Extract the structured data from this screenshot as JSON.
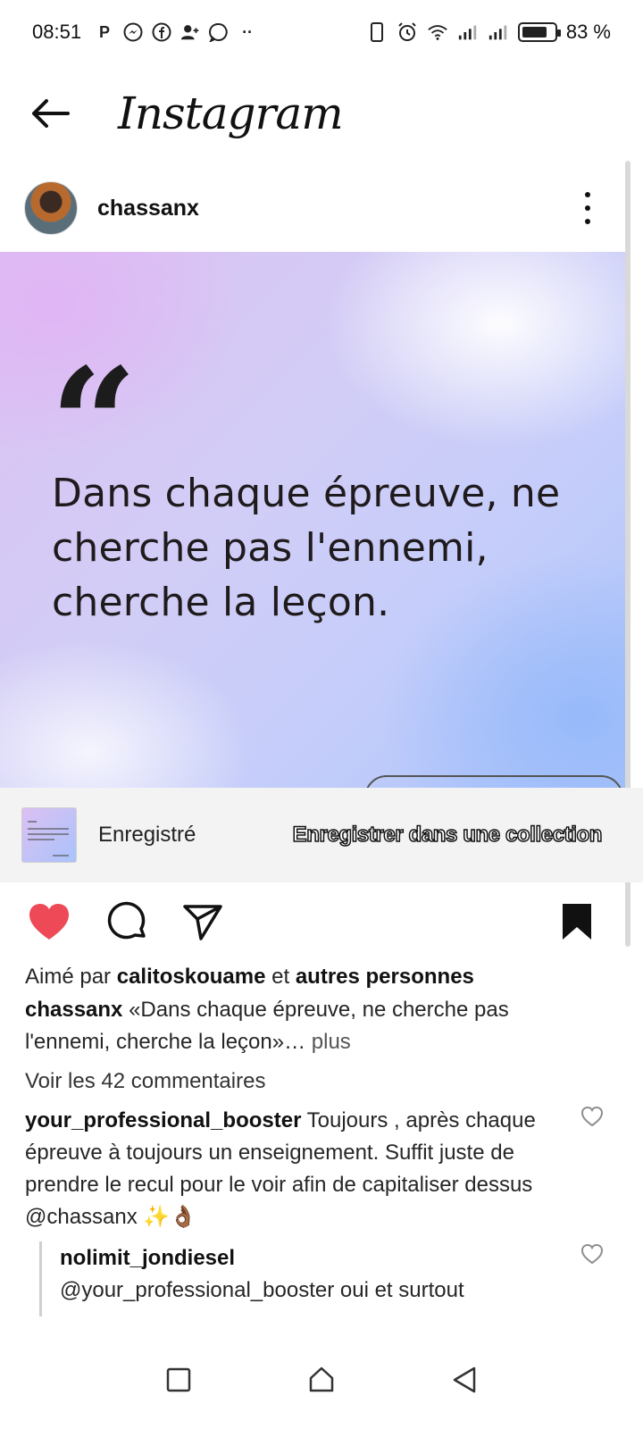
{
  "status_bar": {
    "time": "08:51",
    "battery": "83 %",
    "battery_level": 0.83,
    "left_icons": [
      "p-icon",
      "messenger-icon",
      "facebook-icon",
      "add-contact-icon",
      "whatsapp-icon",
      "more-dots-icon"
    ],
    "right_icons": [
      "vibrate-icon",
      "alarm-icon",
      "wifi-icon",
      "signal-icon",
      "signal-icon",
      "battery-icon"
    ]
  },
  "appbar": {
    "title": "Instagram"
  },
  "post": {
    "username": "chassanx",
    "image": {
      "quote_mark": "“",
      "quote_text": "Dans chaque épreuve, ne cherche pas l'ennemi, cherche la leçon."
    },
    "saved_toast": {
      "label": "Enregistré",
      "action": "Enregistrer dans une collection"
    },
    "liked": true,
    "saved": true,
    "likes": {
      "prefix": "Aimé par",
      "user": "calitoskouame",
      "middle": "et",
      "others": "autres personnes"
    },
    "caption": {
      "user": "chassanx",
      "text": "«Dans chaque épreuve, ne cherche pas l'ennemi, cherche la leçon»…",
      "more": "plus"
    },
    "view_comments": "Voir les 42 commentaires",
    "comments": [
      {
        "user": "your_professional_booster",
        "text": "Toujours , après chaque épreuve à toujours un enseignement. Suffit juste de prendre le recul pour le voir afin de capitaliser dessus @chassanx ✨👌🏾"
      },
      {
        "user": "nolimit_jondiesel",
        "text": "@your_professional_booster oui et surtout"
      }
    ]
  },
  "colors": {
    "like_red": "#ed4956",
    "text": "#262626"
  }
}
